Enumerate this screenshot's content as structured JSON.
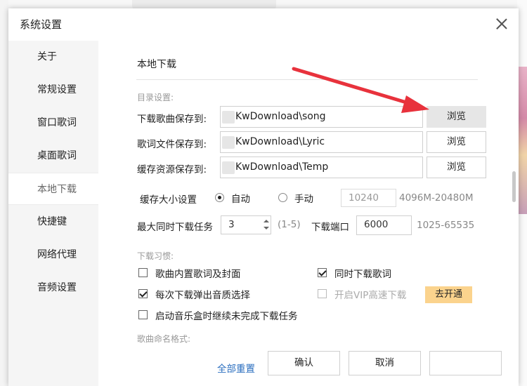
{
  "dialog": {
    "title": "系统设置"
  },
  "sidebar": {
    "items": [
      {
        "label": "关于",
        "active": false
      },
      {
        "label": "常规设置",
        "active": false
      },
      {
        "label": "窗口歌词",
        "active": false
      },
      {
        "label": "桌面歌词",
        "active": false
      },
      {
        "label": "本地下载",
        "active": true
      },
      {
        "label": "快捷键",
        "active": false
      },
      {
        "label": "网络代理",
        "active": false
      },
      {
        "label": "音频设置",
        "active": false
      }
    ]
  },
  "local_download": {
    "title": "本地下载",
    "dir_group_label": "目录设置:",
    "song_dir": {
      "label": "下载歌曲保存到:",
      "value": "KwDownload\\song",
      "browse": "浏览"
    },
    "lyric_dir": {
      "label": "歌词文件保存到:",
      "value": "KwDownload\\Lyric",
      "browse": "浏览"
    },
    "cache_dir": {
      "label": "缓存资源保存到:",
      "value": "KwDownload\\Temp",
      "browse": "浏览"
    },
    "cache_size": {
      "label": "缓存大小设置",
      "auto_label": "自动",
      "manual_label": "手动",
      "selected": "自动",
      "size_value": "10240",
      "size_range": "4096M-20480M"
    },
    "max_tasks": {
      "label": "最大同时下载任务",
      "value": "3",
      "range": "(1-5)"
    },
    "port": {
      "label": "下载端口",
      "value": "6000",
      "range": "1025-65535"
    },
    "habits_group_label": "下载习惯:",
    "habits": {
      "embed_lyrics_cover": {
        "label": "歌曲内置歌词及封面",
        "checked": false
      },
      "download_lyrics": {
        "label": "同时下载歌词",
        "checked": true
      },
      "quality_popup": {
        "label": "每次下载弹出音质选择",
        "checked": true
      },
      "vip_speed": {
        "label": "开启VIP高速下载",
        "checked": false
      },
      "resume_unfinished": {
        "label": "启动音乐盒时继续未完成下载任务",
        "checked": false
      }
    },
    "vip_button": "去开通",
    "naming_group_label": "歌曲命名格式:"
  },
  "footer": {
    "reset": "全部重置",
    "ok": "确认",
    "cancel": "取消"
  },
  "colors": {
    "accent_link": "#2a6ebf",
    "vip_button": "#fbd38d",
    "annotation_arrow": "#e8323c"
  }
}
